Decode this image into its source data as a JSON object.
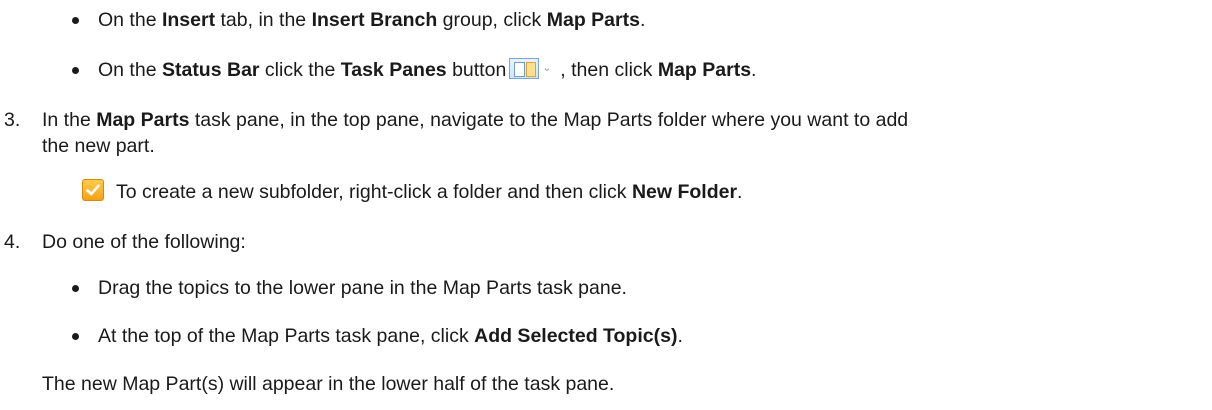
{
  "bullet_insert": {
    "p1": "On the ",
    "b1": "Insert",
    "p2": " tab, in the ",
    "b2": "Insert Branch",
    "p3": " group, click ",
    "b3": "Map Parts",
    "p4": "."
  },
  "bullet_status": {
    "p1": "On the ",
    "b1": "Status Bar",
    "p2": " click the ",
    "b2": "Task Panes",
    "p3": " button",
    "icon": "task-panes-button-icon",
    "p4": ", then click ",
    "b3": "Map Parts",
    "p5": "."
  },
  "step3": {
    "number": "3.",
    "p1": "In the ",
    "b1": "Map Parts",
    "p2": " task pane, in the top pane, navigate to the Map Parts folder where you want to add",
    "line2": "the new part."
  },
  "tip": {
    "icon": "checkmark-tip-icon",
    "p1": "To create a new subfolder, right-click a folder and then click ",
    "b1": "New Folder",
    "p2": "."
  },
  "step4": {
    "number": "4.",
    "text": "Do one of the following:"
  },
  "bullet_drag": {
    "text": "Drag the topics to the lower pane in the Map Parts task pane."
  },
  "bullet_add": {
    "p1": "At the top of the Map Parts task pane, click ",
    "b1": "Add Selected Topic(s)",
    "p2": "."
  },
  "result": {
    "text": "The new Map Part(s) will appear in the lower half of the task pane."
  }
}
